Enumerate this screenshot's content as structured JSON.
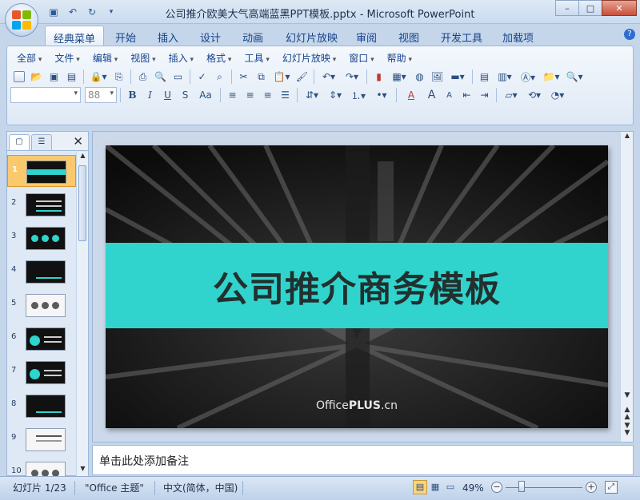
{
  "window": {
    "title": "公司推介欧美大气高端蓝黑PPT模板.pptx - Microsoft PowerPoint",
    "controls": {
      "minimize": "–",
      "maximize": "□",
      "close": "✕"
    }
  },
  "quick_access": [
    "save-icon",
    "undo-icon",
    "redo-icon",
    "customize-icon"
  ],
  "ribbon_tabs": [
    "经典菜单",
    "开始",
    "插入",
    "设计",
    "动画",
    "幻灯片放映",
    "审阅",
    "视图",
    "开发工具",
    "加载项"
  ],
  "active_tab": "经典菜单",
  "classic_menus": [
    "全部",
    "文件",
    "编辑",
    "视图",
    "插入",
    "格式",
    "工具",
    "幻灯片放映",
    "窗口",
    "帮助"
  ],
  "font": {
    "name": "",
    "size": "88"
  },
  "toolbar_glyphs": {
    "bold": "B",
    "italic": "I",
    "underline": "U",
    "shadow": "S",
    "case": "Aa",
    "font_color": "A",
    "grow": "A",
    "shrink": "A"
  },
  "panel": {
    "close": "✕"
  },
  "slides": [
    "1",
    "2",
    "3",
    "4",
    "5",
    "6",
    "7",
    "8",
    "9",
    "10"
  ],
  "current_slide": {
    "title": "公司推介商务模板",
    "brand_prefix": "Office",
    "brand_bold": "PLUS",
    "brand_suffix": ".cn"
  },
  "notes_placeholder": "单击此处添加备注",
  "status": {
    "slide_counter": "幻灯片 1/23",
    "theme": "\"Office 主题\"",
    "language": "中文(简体，中国)",
    "zoom": "49%"
  },
  "colors": {
    "accent": "#30d4cd",
    "selected_thumb": "#fac96c",
    "ribbon_text": "#15428b"
  }
}
